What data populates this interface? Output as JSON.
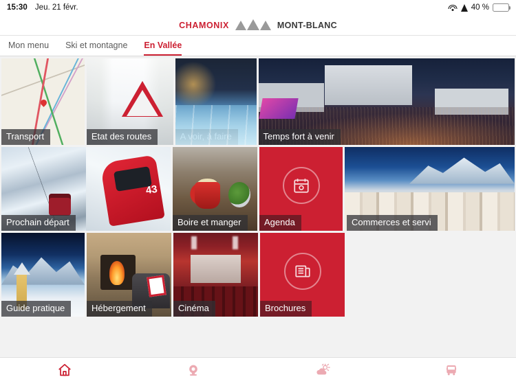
{
  "statusbar": {
    "time": "15:30",
    "date": "Jeu. 21 févr.",
    "wifi_icon": "wifi-icon",
    "location_icon": "location-arrow-icon",
    "battery_percent": "40 %",
    "battery_icon": "battery-icon",
    "battery_level": 40
  },
  "header": {
    "logo_left": "CHAMONIX",
    "logo_mark": "mountain-peaks-icon",
    "logo_right": "MONT-BLANC"
  },
  "tabs": [
    {
      "label": "Mon menu",
      "active": false
    },
    {
      "label": "Ski et montagne",
      "active": false
    },
    {
      "label": "En Vallée",
      "active": true
    }
  ],
  "tiles": {
    "row1": [
      {
        "label": "Transport",
        "style": "photo"
      },
      {
        "label": "Etat des routes",
        "style": "photo"
      },
      {
        "label": "A voir, à faire",
        "style": "photo"
      },
      {
        "label": "Temps fort à venir",
        "style": "photo"
      }
    ],
    "row2": [
      {
        "label": "Prochain départ",
        "style": "photo"
      },
      {
        "label": "Boire et manger",
        "style": "photo"
      },
      {
        "label": "Agenda",
        "style": "red",
        "icon": "calendar-icon"
      },
      {
        "label": "Commerces et servi",
        "style": "photo"
      }
    ],
    "row3": [
      {
        "label": "Guide pratique",
        "style": "photo"
      },
      {
        "label": "Hébergement",
        "style": "photo"
      },
      {
        "label": "Cinéma",
        "style": "photo"
      },
      {
        "label": "Brochures",
        "style": "red",
        "icon": "brochure-icon"
      }
    ]
  },
  "bottomnav": [
    {
      "icon": "home-icon",
      "active": true
    },
    {
      "icon": "webcam-icon",
      "active": false
    },
    {
      "icon": "weather-icon",
      "active": false
    },
    {
      "icon": "bus-icon",
      "active": false
    }
  ],
  "colors": {
    "brand_red": "#cc2032",
    "page_background": "#f2f2f2",
    "label_overlay": "rgba(48,48,52,0.74)",
    "nav_active": "#cc2032",
    "nav_inactive": "#ecaab2",
    "battery_green": "#4cd463"
  }
}
